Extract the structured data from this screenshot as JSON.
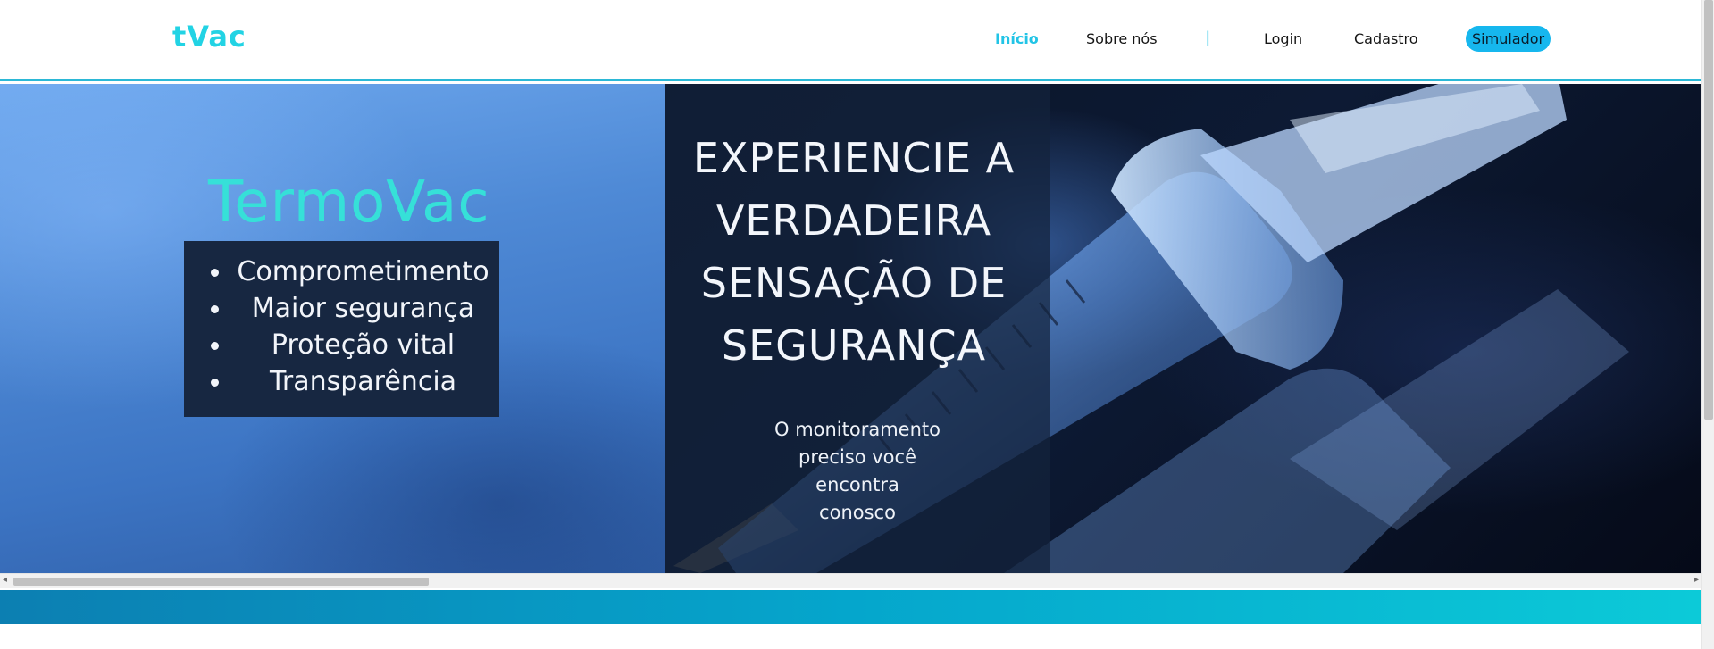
{
  "header": {
    "logo": "tVac",
    "nav": {
      "home": "Início",
      "about": "Sobre nós",
      "separator": "|",
      "login": "Login",
      "register": "Cadastro",
      "simulator": "Simulador"
    }
  },
  "hero": {
    "brand": "TermoVac",
    "features": [
      "Comprometimento",
      "Maior segurança",
      "Proteção vital",
      "Transparência"
    ],
    "headline": [
      "EXPERIENCIE A",
      "VERDADEIRA",
      "SENSAÇÃO DE",
      "SEGURANÇA"
    ],
    "subtext": [
      "O monitoramento",
      "preciso você",
      "encontra",
      "conosco"
    ]
  },
  "colors": {
    "accent": "#22d3e4",
    "nav_active": "#22c4e6",
    "pill": "#16b7ee",
    "feature_box": "#172741",
    "band_start": "#0c7fb2",
    "band_end": "#0ccad8"
  }
}
